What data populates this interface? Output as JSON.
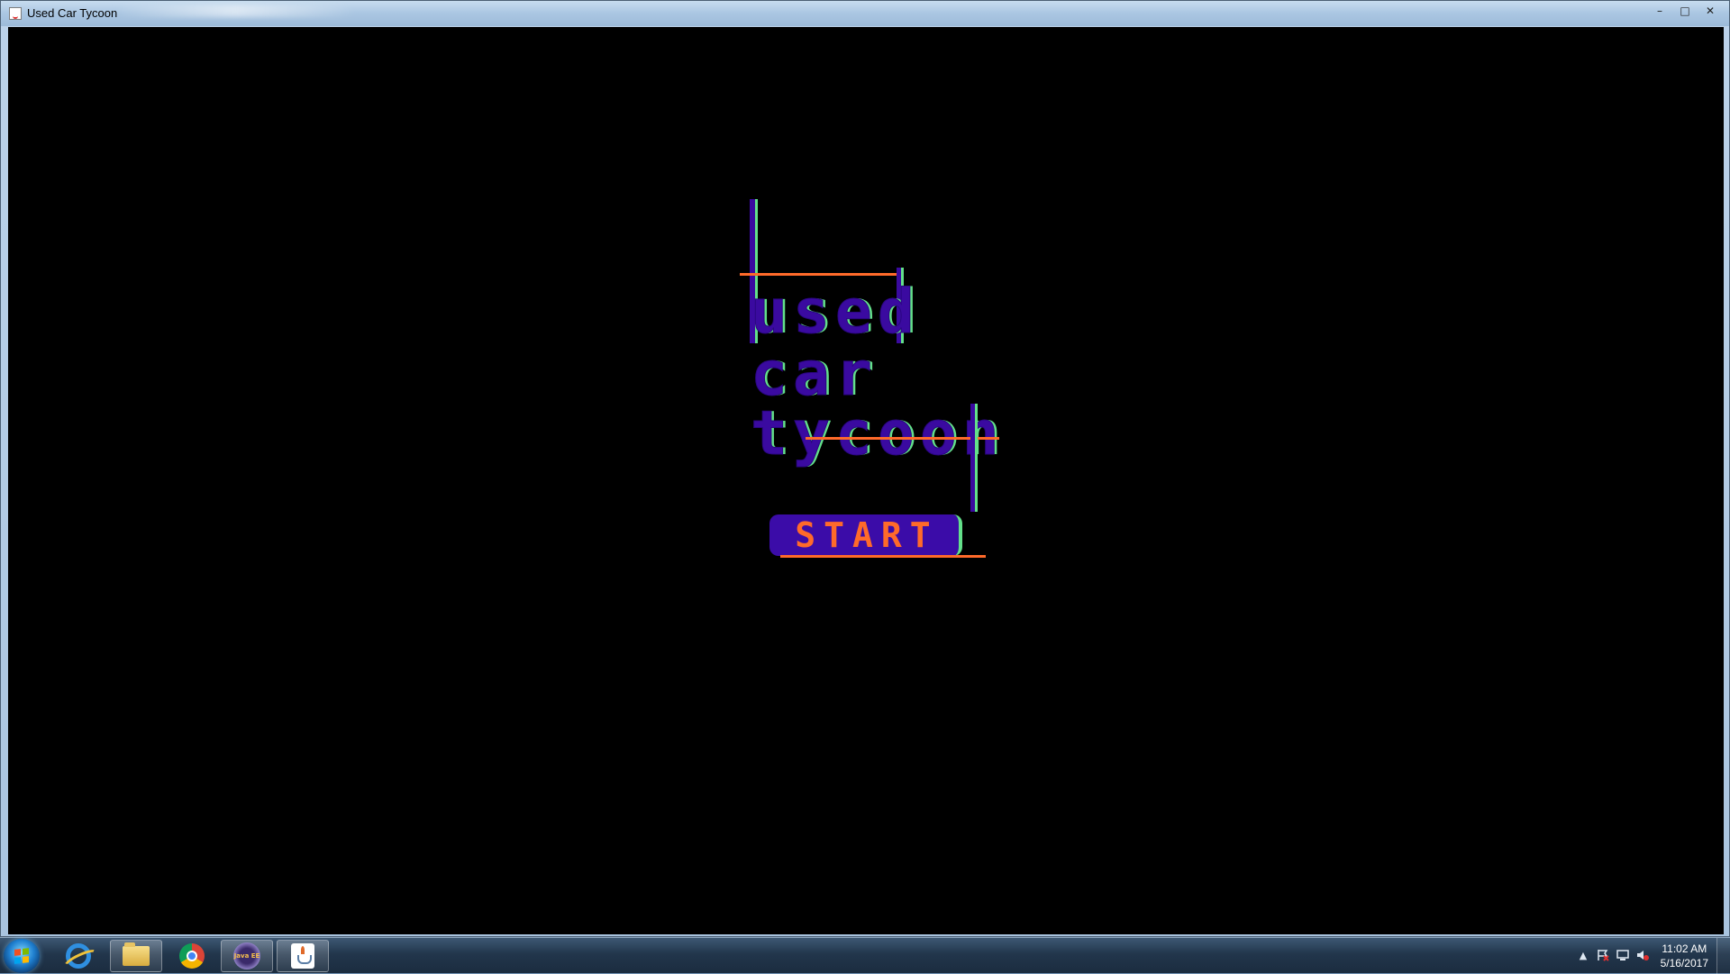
{
  "window": {
    "title": "Used Car Tycoon",
    "controls": {
      "minimize": "–",
      "maximize": "□",
      "close": "✕"
    }
  },
  "game": {
    "logo_lines": [
      "used",
      "car",
      "tycoon"
    ],
    "start_button": "START",
    "colors": {
      "background": "#000000",
      "purple": "#3a0aa0",
      "green": "#63e08a",
      "orange": "#ff6a2a"
    }
  },
  "taskbar": {
    "pinned": [
      {
        "name": "internet-explorer",
        "icon": "ie-icon"
      },
      {
        "name": "file-explorer",
        "icon": "folder-icon"
      },
      {
        "name": "google-chrome",
        "icon": "chrome-icon"
      },
      {
        "name": "eclipse-java-ee",
        "icon": "eclipse-icon",
        "label": "Java EE"
      },
      {
        "name": "java",
        "icon": "java-icon"
      }
    ],
    "tray": {
      "overflow": "▲",
      "time": "11:02 AM",
      "date": "5/16/2017"
    }
  }
}
